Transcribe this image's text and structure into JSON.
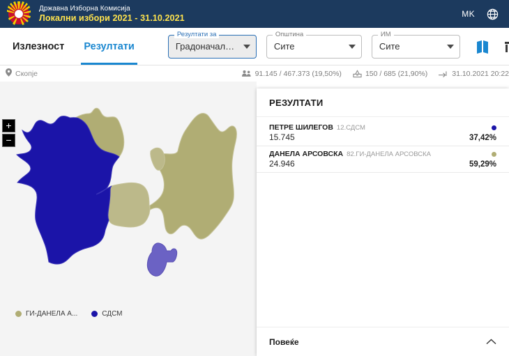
{
  "header": {
    "logo_name": "macedonia-sun-emblem",
    "institution": "Државна Изборна Комисија",
    "election": "Локални избори 2021 - 31.10.2021",
    "lang_code": "MK",
    "globe_icon": "globe-icon"
  },
  "toolbar": {
    "tabs": [
      {
        "label": "Излезност",
        "active": false
      },
      {
        "label": "Резултати",
        "active": true
      }
    ],
    "filters": [
      {
        "legend": "Резултати за",
        "value": "Градоначалник на...",
        "primary": true
      },
      {
        "legend": "Општина",
        "value": "Сите",
        "primary": false
      },
      {
        "legend": "ИМ",
        "value": "Сите",
        "primary": false
      }
    ],
    "icons": [
      {
        "name": "map-view-icon",
        "color": "#1a87d0"
      },
      {
        "name": "bar-chart-view-icon",
        "color": "#3a3a3a"
      }
    ]
  },
  "statusbar": {
    "breadcrumb": "Скопје",
    "pin_icon": "location-pin-icon",
    "stats": [
      {
        "icon": "voters-icon",
        "text": "91.145 / 467.373 (19,50%)"
      },
      {
        "icon": "ballot-box-icon",
        "text": "150 / 685 (21,90%)"
      },
      {
        "icon": "last-update-icon",
        "text": "31.10.2021 20:22"
      }
    ]
  },
  "page": {
    "title": "Скопје"
  },
  "map": {
    "zoom_in_label": "+",
    "zoom_out_label": "−",
    "legend": [
      {
        "label": "ГИ-ДАНЕЛА А...",
        "color": "#b0ad74"
      },
      {
        "label": "СДСМ",
        "color": "#1b14a8"
      }
    ],
    "colors": {
      "blue": "#1b14a8",
      "olive": "#b0ad74",
      "olive_light": "#bcb98a",
      "purple": "#6b62c4",
      "background": "#f4f4f4",
      "border": "#c6c39a"
    }
  },
  "results_panel": {
    "title": "РЕЗУЛТАТИ",
    "candidates": [
      {
        "name": "ПЕТРЕ ШИЛЕГОВ",
        "party": "12.СДСМ",
        "votes": "15.745",
        "percent": "37,42%",
        "color": "#1b14a8"
      },
      {
        "name": "ДАНЕЛА АРСОВСКА",
        "party": "82.ГИ-ДАНЕЛА АРСОВСКА",
        "votes": "24.946",
        "percent": "59,29%",
        "color": "#b0ad74"
      }
    ],
    "footer_label": "Повеќе",
    "footer_icon": "chevron-up-icon"
  }
}
